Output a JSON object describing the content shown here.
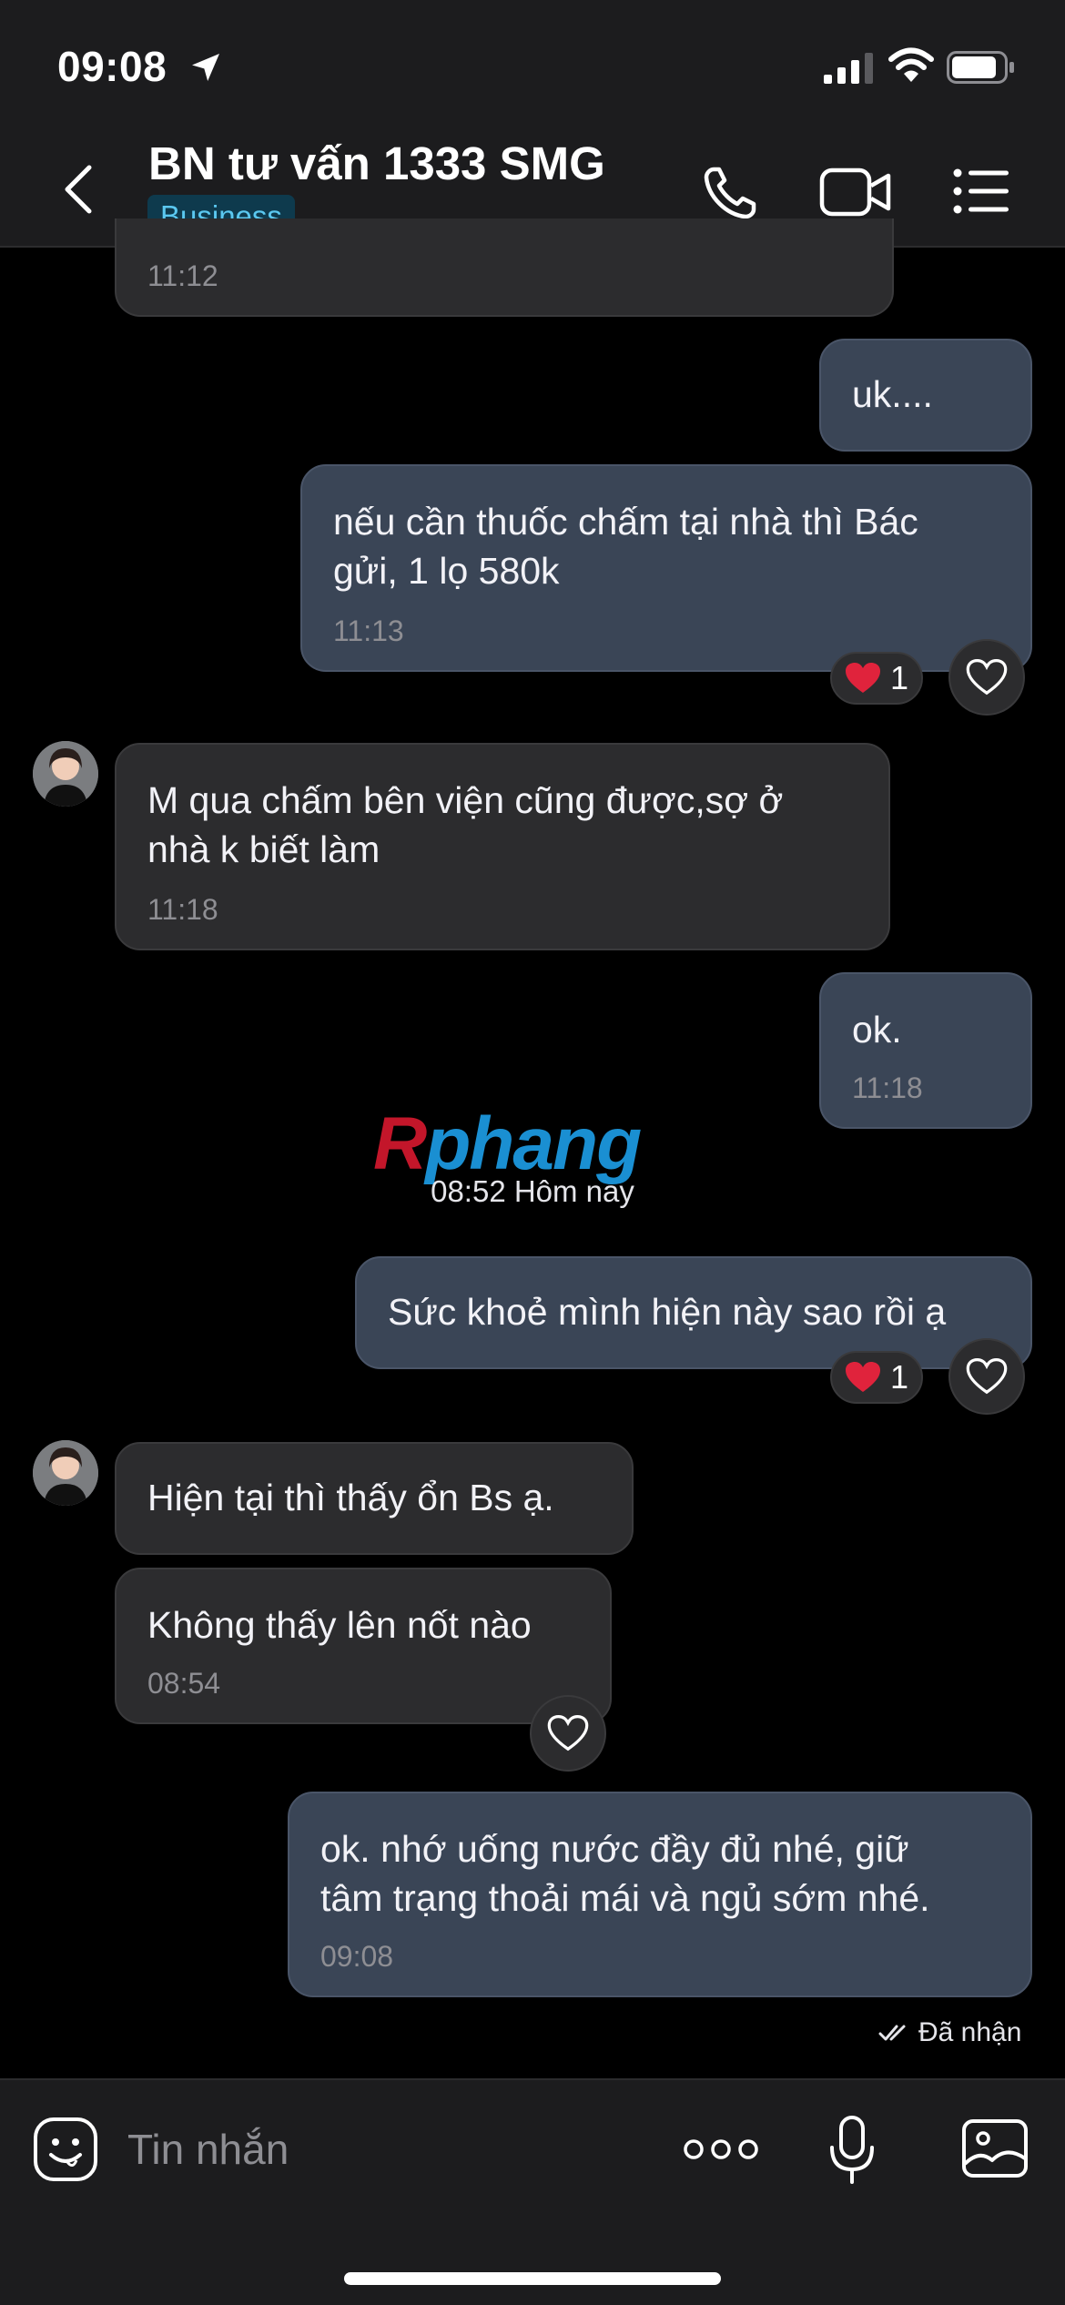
{
  "status_bar": {
    "time": "09:08"
  },
  "header": {
    "title": "BN tư vấn 1333 SMG",
    "badge": "Business"
  },
  "messages": [
    {
      "direction": "in",
      "time": "11:12"
    },
    {
      "direction": "out",
      "text": "uk...."
    },
    {
      "direction": "out",
      "text": "nếu cần thuốc chấm tại nhà thì Bác\ngửi, 1 lọ 580k",
      "time": "11:13",
      "reaction": {
        "emoji": "❤️",
        "count": "1"
      }
    },
    {
      "direction": "in",
      "text": "M qua chấm bên viện cũng được,sợ ở\nnhà k biết làm",
      "time": "11:18"
    },
    {
      "direction": "out",
      "text": "ok.",
      "time": "11:18"
    },
    {
      "direction": "out",
      "text": "Sức khoẻ mình hiện này sao rồi ạ",
      "reaction": {
        "emoji": "❤️",
        "count": "1"
      }
    },
    {
      "direction": "in",
      "text": "Hiện tại thì thấy ổn Bs ạ."
    },
    {
      "direction": "in",
      "text": "Không thấy lên nốt nào",
      "time": "08:54"
    },
    {
      "direction": "out",
      "text": "ok. nhớ uống nước đầy đủ nhé, giữ\ntâm trạng thoải mái và ngủ sớm nhé.",
      "time": "09:08"
    }
  ],
  "day_separator": "08:52 Hôm nay",
  "watermark": {
    "first": "R",
    "rest": "phang"
  },
  "delivery_status": "Đã nhận",
  "composer": {
    "placeholder": "Tin nhắn"
  },
  "icons": {
    "back": "chevron-left-icon",
    "call": "phone-icon",
    "video": "video-camera-icon",
    "menu": "list-menu-icon",
    "sticker": "smiley-icon",
    "more": "ellipsis-icon",
    "mic": "microphone-icon",
    "image": "image-icon",
    "heart": "heart-icon"
  },
  "colors": {
    "incoming_bubble": "#2c2c2e",
    "outgoing_bubble": "#3a4556",
    "badge_bg": "#0e3a4d",
    "badge_text": "#5bc8f0",
    "reaction_heart": "#e0233c"
  }
}
